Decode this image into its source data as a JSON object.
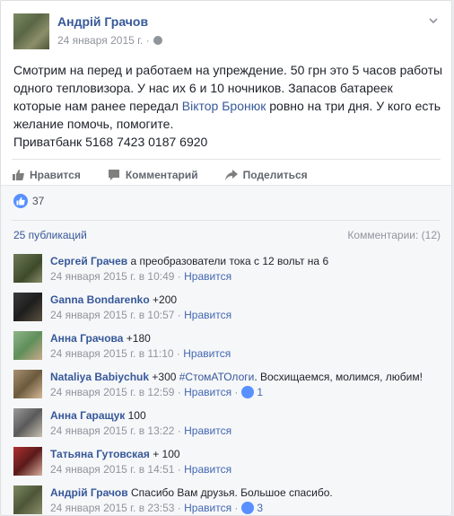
{
  "post": {
    "author": "Андрій Грачов",
    "date": "24 января 2015 г. ·",
    "text_part1": "Смотрим на перед и работаем на упреждение. 50 грн это 5 часов работы одного тепловизора. У нас их 6 и 10 ночников. Запасов батареек которые нам ранее передал ",
    "text_link": "Віктор Бронюк",
    "text_part2": " ровно на три дня. У кого есть желание помочь, помогите.",
    "text_line_last": "Приватбанк 5168 7423 0187 6920"
  },
  "actions": {
    "like": "Нравится",
    "comment": "Комментарий",
    "share": "Поделиться"
  },
  "likes_count": "37",
  "publications": "25 публикаций",
  "comments_count": "Комментарии: (12)",
  "comments": [
    {
      "name": "Сергей Грачев",
      "text": " а преобразователи тока с 12 вольт на 6",
      "tag": "",
      "text2": "",
      "date": "24 января 2015 г. в 10:49",
      "like": "Нравится",
      "likes": ""
    },
    {
      "name": "Ganna Bondarenko",
      "text": " +200",
      "tag": "",
      "text2": "",
      "date": "24 января 2015 г. в 10:57",
      "like": "Нравится",
      "likes": ""
    },
    {
      "name": "Анна Грачова",
      "text": " +180",
      "tag": "",
      "text2": "",
      "date": "24 января 2015 г. в 11:10",
      "like": "Нравится",
      "likes": ""
    },
    {
      "name": "Nataliya Babiychuk",
      "text": " +300 ",
      "tag": "#СтомАТОлоги",
      "text2": ". Восхищаемся, молимся, любим!",
      "date": "24 января 2015 г. в 12:59",
      "like": "Нравится",
      "likes": "1"
    },
    {
      "name": "Анна Гаращук",
      "text": " 100",
      "tag": "",
      "text2": "",
      "date": "24 января 2015 г. в 13:22",
      "like": "Нравится",
      "likes": ""
    },
    {
      "name": "Татьяна Гутовская",
      "text": " + 100",
      "tag": "",
      "text2": "",
      "date": "24 января 2015 г. в 14:51",
      "like": "Нравится",
      "likes": ""
    },
    {
      "name": "Андрій Грачов",
      "text": " Спасибо Вам друзья. Большое спасибо.",
      "tag": "",
      "text2": "",
      "date": "24 января 2015 г. в 23:53",
      "like": "Нравится",
      "likes": "3"
    }
  ],
  "colors": {
    "link": "#365899",
    "meta": "#90949c",
    "like_blue": "#5890ff"
  }
}
